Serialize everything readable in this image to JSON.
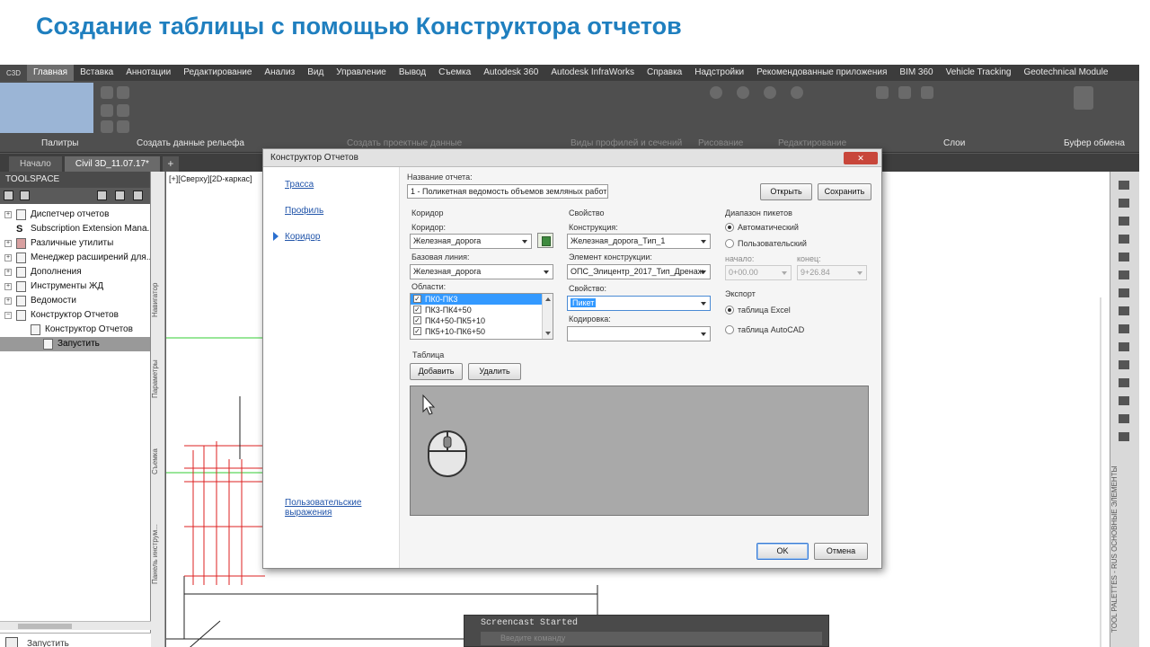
{
  "slide": {
    "title": "Создание таблицы с помощью Конструктора отчетов"
  },
  "ribbon": {
    "app_button": "C3D",
    "tabs": [
      "Главная",
      "Вставка",
      "Аннотации",
      "Редактирование",
      "Анализ",
      "Вид",
      "Управление",
      "Вывод",
      "Съемка",
      "Autodesk 360",
      "Autodesk InfraWorks",
      "Справка",
      "Надстройки",
      "Рекомендованные приложения",
      "BIM 360",
      "Vehicle Tracking",
      "Geotechnical Module"
    ],
    "active_tab": "Главная",
    "groups": [
      "Палитры",
      "Создать данные рельефа",
      "Создать проектные данные",
      "Виды профилей и сечений",
      "Рисование",
      "Редактирование",
      "Слои",
      "Буфер обмена"
    ]
  },
  "doc_tabs": [
    {
      "label": "Начало"
    },
    {
      "label": "Civil 3D_11.07.17*"
    },
    {
      "label": "+"
    }
  ],
  "toolspace": {
    "title": "TOOLSPACE",
    "items": [
      {
        "label": "Диспетчер отчетов",
        "level": 0,
        "expand": "+"
      },
      {
        "label": "Subscription Extension Mana...",
        "level": 0,
        "expand": ""
      },
      {
        "label": "Различные утилиты",
        "level": 0,
        "expand": "+"
      },
      {
        "label": "Менеджер расширений для...",
        "level": 0,
        "expand": "+"
      },
      {
        "label": "Дополнения",
        "level": 0,
        "expand": "+"
      },
      {
        "label": "Инструменты ЖД",
        "level": 0,
        "expand": "+"
      },
      {
        "label": "Ведомости",
        "level": 0,
        "expand": "+"
      },
      {
        "label": "Конструктор Отчетов",
        "level": 0,
        "expand": "−"
      },
      {
        "label": "Конструктор Отчетов",
        "level": 1,
        "expand": ""
      },
      {
        "label": "Запустить",
        "level": 2,
        "expand": ""
      }
    ],
    "bottom_label": "Запустить"
  },
  "side_strip": [
    "Навигатор",
    "Параметры",
    "Съемка",
    "Панель инструм..."
  ],
  "viewport_label": "[+][Сверху][2D-каркас]",
  "right_palette": {
    "text": "TOOL PALETTES - RUS ОСНОВНЫЕ ЭЛЕМЕНТЫ"
  },
  "command_line": {
    "history": "Screencast Started",
    "placeholder": "Введите команду"
  },
  "dialog": {
    "title": "Конструктор Отчетов",
    "close": "✕",
    "nav": {
      "links": [
        "Трасса",
        "Профиль",
        "Коридор"
      ],
      "active": "Коридор",
      "bottom_link": "Пользовательские выражения"
    },
    "report_name_label": "Название отчета:",
    "report_name_value": "1 - Поликетная ведомость объемов земляных работ",
    "open_button": "Открыть",
    "save_button": "Сохранить",
    "corridor_section": "Коридор",
    "corridor_label": "Коридор:",
    "corridor_value": "Железная_дорога",
    "baseline_label": "Базовая линия:",
    "baseline_value": "Железная_дорога",
    "regions_label": "Области:",
    "regions": [
      {
        "label": "ПК0-ПК3",
        "checked": true,
        "selected": true
      },
      {
        "label": "ПК3-ПК4+50",
        "checked": true,
        "selected": false
      },
      {
        "label": "ПК4+50-ПК5+10",
        "checked": true,
        "selected": false
      },
      {
        "label": "ПК5+10-ПК6+50",
        "checked": true,
        "selected": false
      }
    ],
    "property_section": "Свойство",
    "construction_label": "Конструкция:",
    "construction_value": "Железная_дорога_Тип_1",
    "element_label": "Элемент конструкции:",
    "element_value": "ОПС_Элицентр_2017_Тип_Дренаж",
    "property_label": "Свойство:",
    "property_value": "Пикет",
    "encoding_label": "Кодировка:",
    "encoding_value": "",
    "station_range_section": "Диапазон пикетов",
    "auto_label": "Автоматический",
    "custom_label": "Пользовательский",
    "start_label": "начало:",
    "end_label": "конец:",
    "start_value": "0+00.00",
    "end_value": "9+26.84",
    "export_section": "Экспорт",
    "excel_label": "таблица Excel",
    "autocad_label": "таблица AutoCAD",
    "table_section": "Таблица",
    "add_button": "Добавить",
    "delete_button": "Удалить",
    "ok_button": "OK",
    "cancel_button": "Отмена"
  },
  "colors": {
    "title_blue": "#1f7fbf",
    "accent_blue": "#3399ff",
    "ribbon_dark": "#4f4f4f"
  }
}
